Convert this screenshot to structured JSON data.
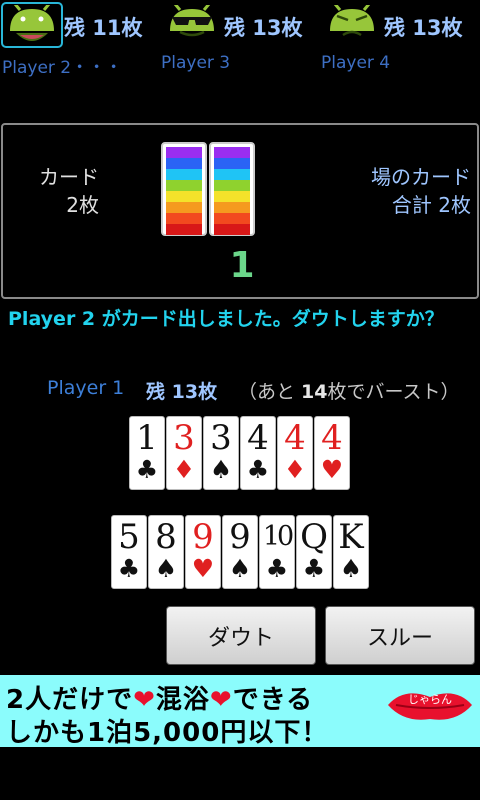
{
  "opponents": [
    {
      "name": "Player 2・・・",
      "count": "残 11枚",
      "selected": true,
      "face": "happy"
    },
    {
      "name": "Player 3",
      "count": "残 13枚",
      "selected": false,
      "face": "sunglasses"
    },
    {
      "name": "Player 4",
      "count": "残 13枚",
      "selected": false,
      "face": "grumpy"
    }
  ],
  "field": {
    "cards_label_line1": "カード",
    "cards_label_line2": "2枚",
    "total_label_line1": "場のカード",
    "total_label_line2": "合計  2枚",
    "declared_rank": "1",
    "stack_colors": [
      "#9a2ef0",
      "#2a63f5",
      "#1fc4f5",
      "#8fd22e",
      "#f4e22a",
      "#f59a1f",
      "#f24a1f",
      "#d81818"
    ]
  },
  "message": {
    "player": "Player 2",
    "text": " がカード出しました。ダウトしますか？"
  },
  "player": {
    "name": "Player 1",
    "count_prefix": "残 ",
    "count_value": "13",
    "count_suffix": "枚",
    "burst_open": "（あと ",
    "burst_value": "14",
    "burst_close": "枚でバースト）"
  },
  "hand_row1": [
    {
      "rank": "1",
      "suit": "♣",
      "color": "black"
    },
    {
      "rank": "3",
      "suit": "♦",
      "color": "red"
    },
    {
      "rank": "3",
      "suit": "♠",
      "color": "black"
    },
    {
      "rank": "4",
      "suit": "♣",
      "color": "black"
    },
    {
      "rank": "4",
      "suit": "♦",
      "color": "red"
    },
    {
      "rank": "4",
      "suit": "♥",
      "color": "red"
    }
  ],
  "hand_row2": [
    {
      "rank": "5",
      "suit": "♣",
      "color": "black"
    },
    {
      "rank": "8",
      "suit": "♠",
      "color": "black"
    },
    {
      "rank": "9",
      "suit": "♥",
      "color": "red"
    },
    {
      "rank": "9",
      "suit": "♠",
      "color": "black"
    },
    {
      "rank": "10",
      "suit": "♣",
      "color": "black"
    },
    {
      "rank": "Q",
      "suit": "♣",
      "color": "black"
    },
    {
      "rank": "K",
      "suit": "♠",
      "color": "black"
    }
  ],
  "buttons": {
    "doubt": "ダウト",
    "pass": "スルー"
  },
  "ad": {
    "line1_a": "2人だけで",
    "line1_heart": "❤",
    "line1_b": "混浴",
    "line1_heart2": "❤",
    "line1_c": "できる",
    "line2": "しかも1泊5,000円以下！",
    "lips_text": "じゃらん"
  },
  "colors": {
    "accent_cyan": "#22d3ee",
    "label_blue": "#9fc6ff",
    "name_blue": "#3d6fc4",
    "rank_green": "#6bd68a",
    "ad_bg": "#8bfcfc",
    "android_green": "#97c63a"
  }
}
